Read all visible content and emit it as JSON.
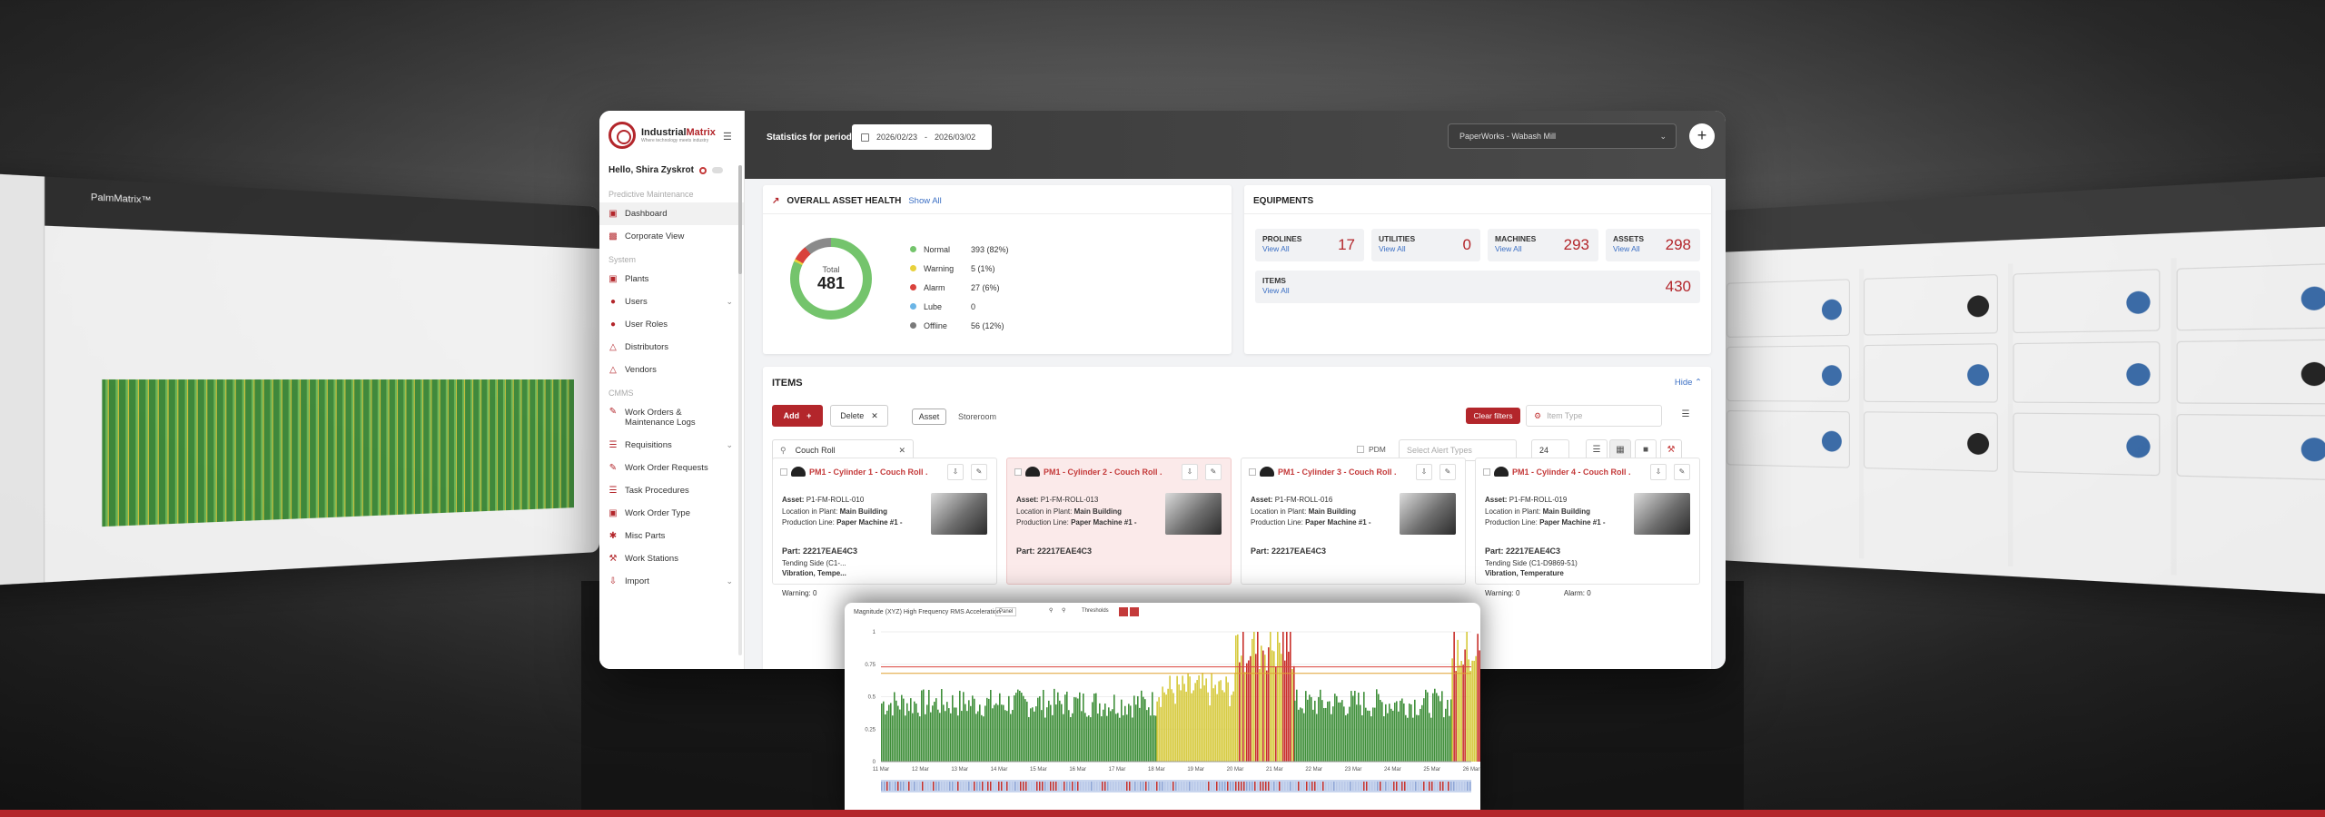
{
  "left_preview": {
    "app": "PalmMatrix™"
  },
  "sidebar": {
    "brand": "IndustrialMatrix",
    "brand_accent": "Matrix",
    "brand_tag": "Where technology meets industry",
    "greeting": "Hello, Shira Zyskrot",
    "sections": {
      "pm": "Predictive Maintenance",
      "system": "System",
      "cmms": "CMMS"
    },
    "items": [
      {
        "label": "Dashboard",
        "icon": "dashboard-icon"
      },
      {
        "label": "Corporate View",
        "icon": "building-icon"
      },
      {
        "label": "Plants",
        "icon": "factory-icon"
      },
      {
        "label": "Users",
        "icon": "users-icon"
      },
      {
        "label": "User Roles",
        "icon": "user-role-icon"
      },
      {
        "label": "Distributors",
        "icon": "distributor-icon"
      },
      {
        "label": "Vendors",
        "icon": "vendor-icon"
      },
      {
        "label": "Work Orders & Maintenance Logs",
        "icon": "work-order-icon"
      },
      {
        "label": "Requisitions",
        "icon": "requisition-icon"
      },
      {
        "label": "Work Order Requests",
        "icon": "request-icon"
      },
      {
        "label": "Task Procedures",
        "icon": "procedure-icon"
      },
      {
        "label": "Work Order Type",
        "icon": "type-icon"
      },
      {
        "label": "Misc Parts",
        "icon": "parts-icon"
      },
      {
        "label": "Work Stations",
        "icon": "station-icon"
      },
      {
        "label": "Import",
        "icon": "import-icon"
      }
    ]
  },
  "topbar": {
    "period_label": "Statistics for period:",
    "date_from": "2026/02/23",
    "date_sep": "-",
    "date_to": "2026/03/02",
    "location": "PaperWorks - Wabash Mill"
  },
  "health": {
    "title": "OVERALL ASSET HEALTH",
    "show_all": "Show All",
    "total_label": "Total",
    "total": "481",
    "legend": [
      {
        "name": "Normal",
        "value": "393 (82%)",
        "color": "#74c46c"
      },
      {
        "name": "Warning",
        "value": "5 (1%)",
        "color": "#e8d13c"
      },
      {
        "name": "Alarm",
        "value": "27 (6%)",
        "color": "#d9423c"
      },
      {
        "name": "Lube",
        "value": "0",
        "color": "#6bb5e6"
      },
      {
        "name": "Offline",
        "value": "56 (12%)",
        "color": "#7a7a7a"
      }
    ]
  },
  "equipments": {
    "title": "EQUIPMENTS",
    "view_all": "View All",
    "boxes": [
      {
        "name": "PROLINES",
        "value": "17"
      },
      {
        "name": "UTILITIES",
        "value": "0"
      },
      {
        "name": "MACHINES",
        "value": "293"
      },
      {
        "name": "ASSETS",
        "value": "298"
      },
      {
        "name": "ITEMS",
        "value": "430"
      }
    ]
  },
  "items": {
    "title": "ITEMS",
    "hide": "Hide",
    "add": "Add",
    "delete": "Delete",
    "asset": "Asset",
    "storeroom": "Storeroom",
    "clear_filters": "Clear filters",
    "item_type_placeholder": "Item Type",
    "search_value": "Couch Roll",
    "pdm": "PDM",
    "alert_types_placeholder": "Select Alert Types",
    "page_size": "24",
    "cards": [
      {
        "title": "PM1 - Cylinder 1 - Couch Roll ...",
        "asset": "P1-FM-ROLL-010",
        "location": "Main Building",
        "line": "Paper Machine #1 -",
        "part": "Part: 22217EAE4C3",
        "sub1": "Tending Side (C1-...",
        "sub2": "Vibration, Tempe...",
        "warning": "Warning: 0"
      },
      {
        "title": "PM1 - Cylinder 2 - Couch Roll ...",
        "asset": "P1-FM-ROLL-013",
        "location": "Main Building",
        "line": "Paper Machine #1 -",
        "part": "Part: 22217EAE4C3",
        "sub1": "",
        "sub2": "",
        "warning": ""
      },
      {
        "title": "PM1 - Cylinder 3 - Couch Roll ...",
        "asset": "P1-FM-ROLL-016",
        "location": "Main Building",
        "line": "Paper Machine #1 -",
        "part": "Part: 22217EAE4C3",
        "sub1": "",
        "sub2": "",
        "warning": ""
      },
      {
        "title": "PM1 - Cylinder 4 - Couch Roll ...",
        "asset": "P1-FM-ROLL-019",
        "location": "Main Building",
        "line": "Paper Machine #1 -",
        "part": "Part: 22217EAE4C3",
        "sub1": "Tending Side (C1-D9869-51)",
        "sub2": "Vibration, Temperature",
        "warning": "Warning: 0",
        "alarm": "Alarm: 0"
      }
    ],
    "labels": {
      "asset": "Asset:",
      "location": "Location in Plant:",
      "line": "Production Line:"
    }
  },
  "chart_popup": {
    "title": "Magnitude (XYZ) High Frequency RMS Acceleration",
    "btn_panel": "Panel",
    "btn_thresholds": "Thresholds",
    "chart_data": {
      "type": "bar",
      "title": "Magnitude (XYZ) High Frequency RMS Acceleration",
      "x_ticks": [
        "11 Mar",
        "12 Mar",
        "13 Mar",
        "14 Mar",
        "15 Mar",
        "16 Mar",
        "17 Mar",
        "18 Mar",
        "19 Mar",
        "20 Mar",
        "21 Mar",
        "22 Mar",
        "23 Mar",
        "24 Mar",
        "25 Mar",
        "26 Mar"
      ],
      "y_ticks": [
        "0",
        "0.25",
        "0.5",
        "0.75",
        "1"
      ],
      "ylim": [
        0,
        1
      ],
      "thresholds": {
        "warning": 0.68,
        "alarm": 0.73
      },
      "segments": [
        {
          "from": 0,
          "to": 7,
          "level": 0.45,
          "status": "normal"
        },
        {
          "from": 7,
          "to": 9,
          "level": 0.55,
          "status": "warning"
        },
        {
          "from": 9,
          "to": 10.5,
          "level": 0.9,
          "status": "alarm"
        },
        {
          "from": 10.5,
          "to": 14.5,
          "level": 0.45,
          "status": "normal"
        },
        {
          "from": 14.5,
          "to": 15.5,
          "level": 0.85,
          "status": "alarm"
        },
        {
          "from": 15.5,
          "to": 16,
          "level": 0.45,
          "status": "normal"
        }
      ],
      "colors": {
        "normal": "#3f8f3a",
        "warning": "#d6c93a",
        "alarm": "#c8302b"
      }
    }
  }
}
